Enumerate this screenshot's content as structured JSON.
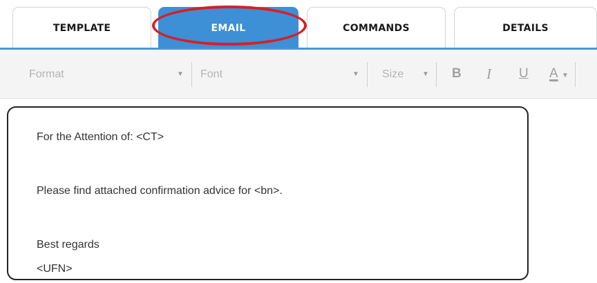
{
  "tabs": [
    {
      "label": "TEMPLATE",
      "active": false
    },
    {
      "label": "EMAIL",
      "active": true
    },
    {
      "label": "COMMANDS",
      "active": false
    },
    {
      "label": "DETAILS",
      "active": false
    }
  ],
  "toolbar": {
    "format_placeholder": "Format",
    "font_placeholder": "Font",
    "size_placeholder": "Size",
    "bold_label": "B",
    "italic_label": "I",
    "underline_label": "U",
    "text_color_label": "A"
  },
  "editor": {
    "lines": [
      "For the Attention of: <CT>",
      "Please find attached confirmation advice for <bn>.",
      "Best regards",
      "<UFN>"
    ]
  },
  "colors": {
    "active_tab": "#3d8fd6",
    "highlight_circle": "#d61f26",
    "tab_underline": "#4a94d4"
  }
}
